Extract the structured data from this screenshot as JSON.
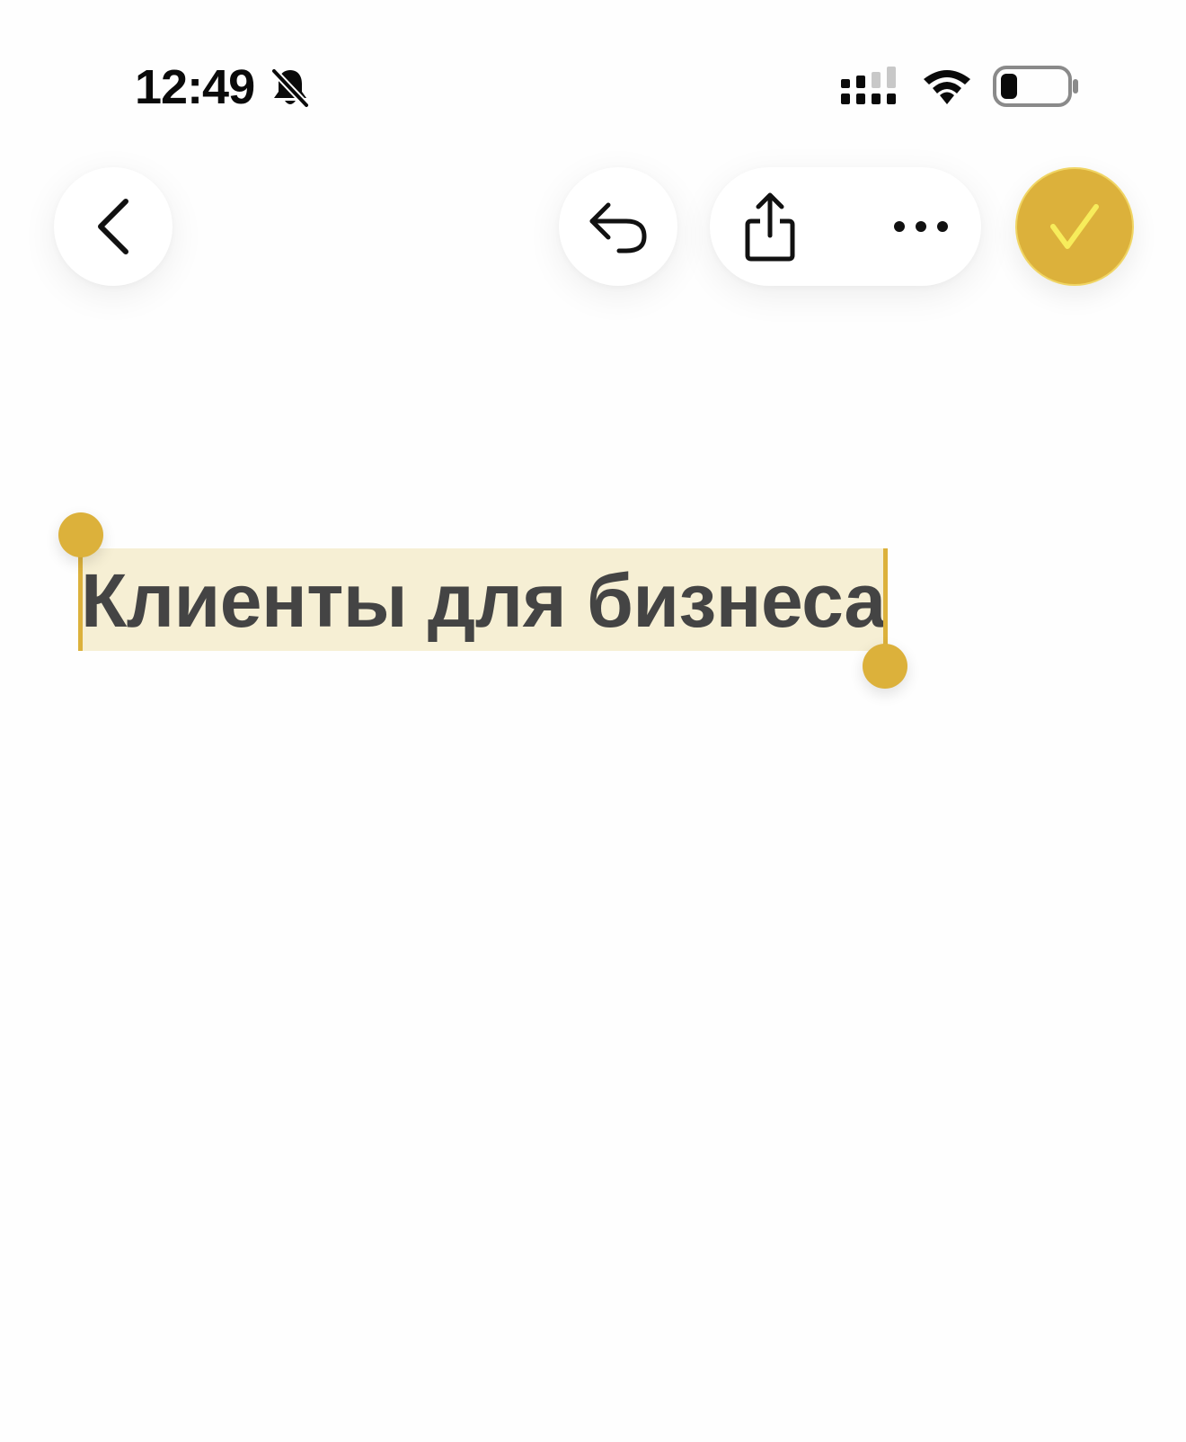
{
  "status_bar": {
    "time": "12:49",
    "icons": [
      "bell-slash-icon",
      "cellular-signal-icon",
      "wifi-icon",
      "battery-icon"
    ],
    "battery_level": 0.2
  },
  "toolbar": {
    "back_icon": "chevron-left-icon",
    "undo_icon": "undo-icon",
    "share_icon": "share-icon",
    "more_icon": "ellipsis-icon",
    "done_icon": "checkmark-icon"
  },
  "editor": {
    "title": "Клиенты для бизнеса",
    "title_selected": true
  },
  "colors": {
    "accent": "#dcb13b",
    "accent_check": "#f7ec5b",
    "selection": "#f6efd4",
    "title_text": "#444444"
  }
}
